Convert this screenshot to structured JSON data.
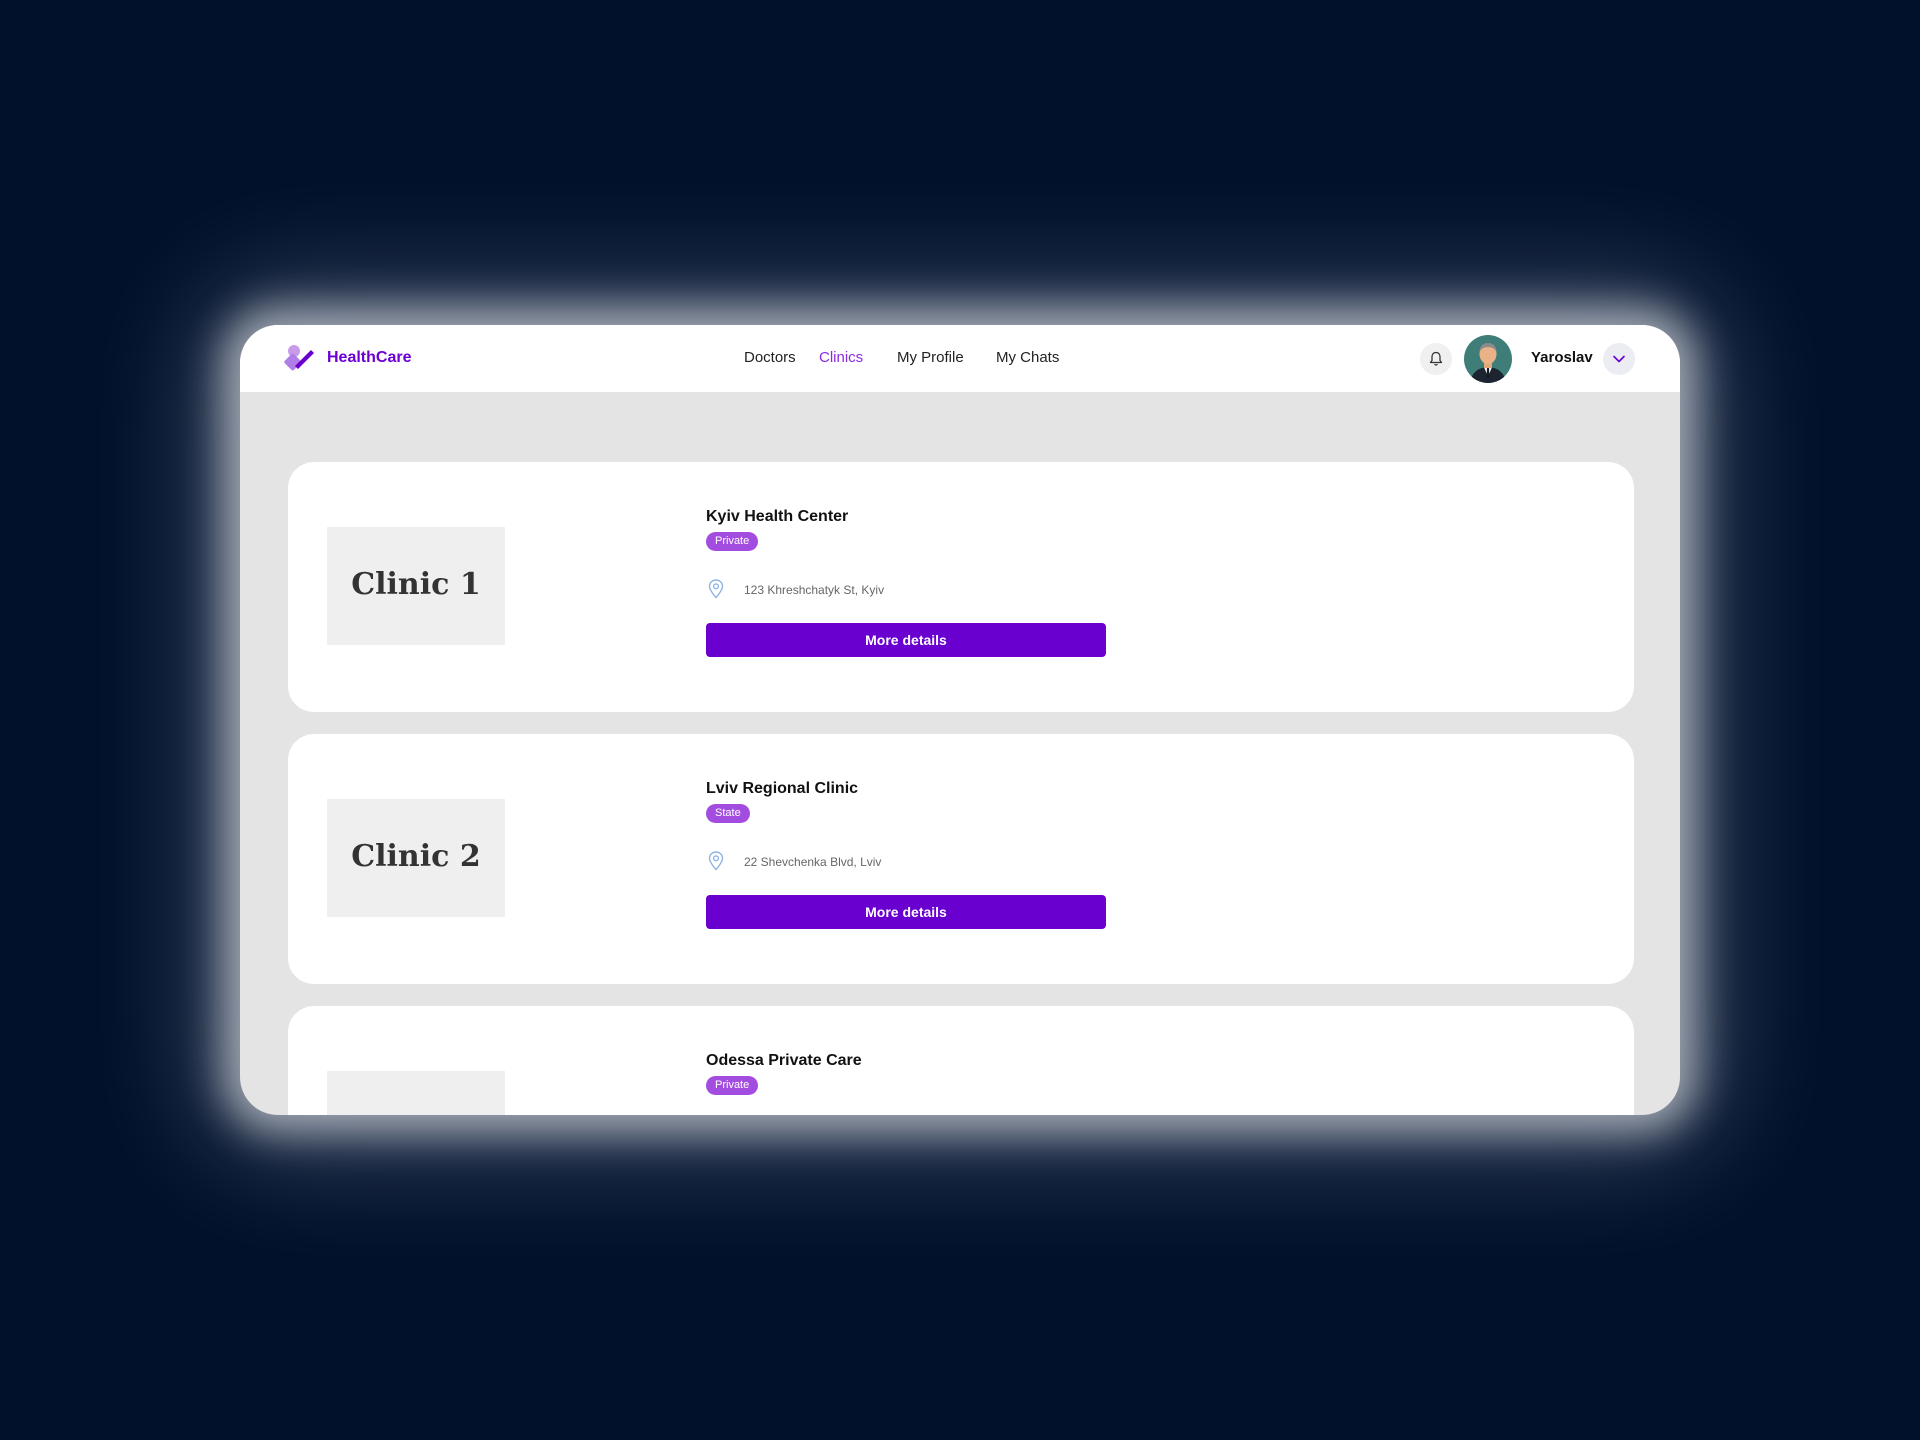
{
  "header": {
    "brand": "HealthCare",
    "nav": [
      {
        "label": "Doctors",
        "active": false
      },
      {
        "label": "Clinics",
        "active": true
      },
      {
        "label": "My Profile",
        "active": false
      },
      {
        "label": "My Chats",
        "active": false
      }
    ],
    "user_name": "Yaroslav",
    "icons": [
      "bell-icon",
      "chevron-down-icon"
    ]
  },
  "colors": {
    "accent": "#6a00d0",
    "active_nav": "#8a2be2",
    "badge": "#a34de0",
    "backdrop": "#02112b"
  },
  "clinics": [
    {
      "image_label": "Clinic 1",
      "name": "Kyiv Health Center",
      "type": "Private",
      "address": "123 Khreshchatyk St, Kyiv",
      "button": "More details"
    },
    {
      "image_label": "Clinic 2",
      "name": "Lviv Regional Clinic",
      "type": "State",
      "address": "22 Shevchenka Blvd, Lviv",
      "button": "More details"
    },
    {
      "name": "Odessa Private Care",
      "type": "Private"
    }
  ]
}
